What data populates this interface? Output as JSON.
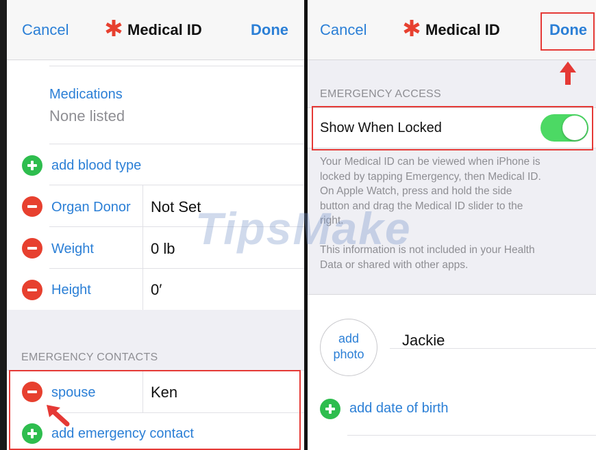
{
  "left": {
    "nav": {
      "cancel": "Cancel",
      "title": "Medical ID",
      "done": "Done"
    },
    "medications": {
      "label": "Medications",
      "value": "None listed"
    },
    "add_blood_type": "add blood type",
    "rows": [
      {
        "label": "Organ Donor",
        "value": "Not Set"
      },
      {
        "label": "Weight",
        "value": "0 lb"
      },
      {
        "label": "Height",
        "value": "0′"
      }
    ],
    "emergency_contacts_header": "EMERGENCY CONTACTS",
    "contact": {
      "relation": "spouse",
      "name": "Ken"
    },
    "add_emergency_contact": "add emergency contact"
  },
  "right": {
    "nav": {
      "cancel": "Cancel",
      "title": "Medical ID",
      "done": "Done"
    },
    "emergency_access_header": "EMERGENCY ACCESS",
    "show_when_locked": {
      "label": "Show When Locked",
      "enabled": true
    },
    "footer_lines": [
      "Your Medical ID can be viewed when iPhone is",
      "locked by tapping Emergency, then Medical ID.",
      "On Apple Watch, press and hold the side",
      "button and drag the Medical ID slider to the",
      "right."
    ],
    "footer2_lines": [
      "This information is not included in your Health",
      "Data or shared with other apps."
    ],
    "photo": {
      "line1": "add",
      "line2": "photo"
    },
    "name": "Jackie",
    "add_date_of_birth": "add date of birth"
  },
  "watermark": "TipsMake",
  "colors": {
    "accent": "#2b7fd6",
    "delete": "#e7402f",
    "add": "#2ebd4e",
    "toggle_on": "#4cd964",
    "highlight": "#e53935"
  }
}
